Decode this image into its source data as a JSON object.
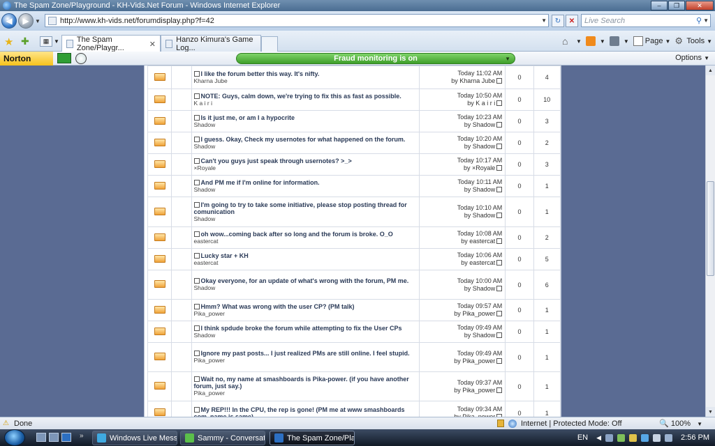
{
  "window": {
    "title": "The Spam Zone/Playground - KH-Vids.Net Forum - Windows Internet Explorer",
    "min_glyph": "–",
    "max_glyph": "❐",
    "close_glyph": "✕"
  },
  "address_bar": {
    "url": "http://www.kh-vids.net/forumdisplay.php?f=42",
    "search_placeholder": "Live Search"
  },
  "tabs": [
    {
      "label": "The Spam Zone/Playgr...",
      "active": true
    },
    {
      "label": "Hanzo Kimura's Game Log...",
      "active": false
    }
  ],
  "command_bar": {
    "page_label": "Page",
    "tools_label": "Tools"
  },
  "norton": {
    "logo": "Norton",
    "status": "Fraud monitoring is on",
    "options_label": "Options"
  },
  "threads": [
    {
      "title": "I like the forum better this way. It's nifty.",
      "author": "Kharna Jube",
      "last_time": "Today 11:02 AM",
      "last_by": "by Kharna Jube",
      "replies": "0",
      "views": "4"
    },
    {
      "title": "NOTE: Guys, calm down, we're trying to fix this as fast as possible.",
      "author": "K a i r i",
      "last_time": "Today 10:50 AM",
      "last_by": "by K a i r i",
      "replies": "0",
      "views": "10"
    },
    {
      "title": "Is it just me, or am I a hypocrite",
      "author": "Shadow",
      "last_time": "Today 10:23 AM",
      "last_by": "by Shadow",
      "replies": "0",
      "views": "3"
    },
    {
      "title": "I guess. Okay, Check my usernotes for what happened on the forum.",
      "author": "Shadow",
      "last_time": "Today 10:20 AM",
      "last_by": "by Shadow",
      "replies": "0",
      "views": "2"
    },
    {
      "title": "Can't you guys just speak through usernotes? >_>",
      "author": "×Royale",
      "last_time": "Today 10:17 AM",
      "last_by": "by ×Royale",
      "replies": "0",
      "views": "3"
    },
    {
      "title": "And PM me if I'm online for information.",
      "author": "Shadow",
      "last_time": "Today 10:11 AM",
      "last_by": "by Shadow",
      "replies": "0",
      "views": "1"
    },
    {
      "title": "I'm going to try to take some initiative, please stop posting thread for comunication",
      "author": "Shadow",
      "last_time": "Today 10:10 AM",
      "last_by": "by Shadow",
      "replies": "0",
      "views": "1"
    },
    {
      "title": "oh wow...coming back after so long and the forum is broke. O_O",
      "author": "eastercat",
      "last_time": "Today 10:08 AM",
      "last_by": "by eastercat",
      "replies": "0",
      "views": "2"
    },
    {
      "title": "Lucky star + KH",
      "author": "eastercat",
      "last_time": "Today 10:06 AM",
      "last_by": "by eastercat",
      "replies": "0",
      "views": "5"
    },
    {
      "title": "Okay everyone, for an update of what's wrong with the forum, PM me.",
      "author": "Shadow",
      "last_time": "Today 10:00 AM",
      "last_by": "by Shadow",
      "replies": "0",
      "views": "6"
    },
    {
      "title": "Hmm? What was wrong with the user CP? (PM talk)",
      "author": "Pika_power",
      "last_time": "Today 09:57 AM",
      "last_by": "by Pika_power",
      "replies": "0",
      "views": "1"
    },
    {
      "title": "I think spdude broke the forum while attempting to fix the User CPs",
      "author": "Shadow",
      "last_time": "Today 09:49 AM",
      "last_by": "by Shadow",
      "replies": "0",
      "views": "1"
    },
    {
      "title": "Ignore my past posts... I just realized PMs are still online. I feel stupid.",
      "author": "Pika_power",
      "last_time": "Today 09:49 AM",
      "last_by": "by Pika_power",
      "replies": "0",
      "views": "1"
    },
    {
      "title": "Wait no, my name at smashboards is Pika-power. (if you have another forum, just say.)",
      "author": "Pika_power",
      "last_time": "Today 09:37 AM",
      "last_by": "by Pika_power",
      "replies": "0",
      "views": "1"
    },
    {
      "title": "My REP!!! In the CPU, the rep is gone! (PM me at www smashboards com, name is same)",
      "author": "",
      "last_time": "Today 09:34 AM",
      "last_by": "by Pika_power",
      "replies": "0",
      "views": "1"
    }
  ],
  "status_bar": {
    "text": "Done",
    "zone": "Internet | Protected Mode: Off",
    "zoom": "100%"
  },
  "taskbar": {
    "tasks": [
      {
        "label": "Windows Live Mess...",
        "active": false,
        "color": "#3fa9e0"
      },
      {
        "label": "Sammy - Conversati...",
        "active": false,
        "color": "#5bbf4a"
      },
      {
        "label": "The Spam Zone/Pla...",
        "active": true,
        "color": "#2c6fc2"
      }
    ],
    "lang": "EN",
    "clock": "2:56 PM"
  }
}
